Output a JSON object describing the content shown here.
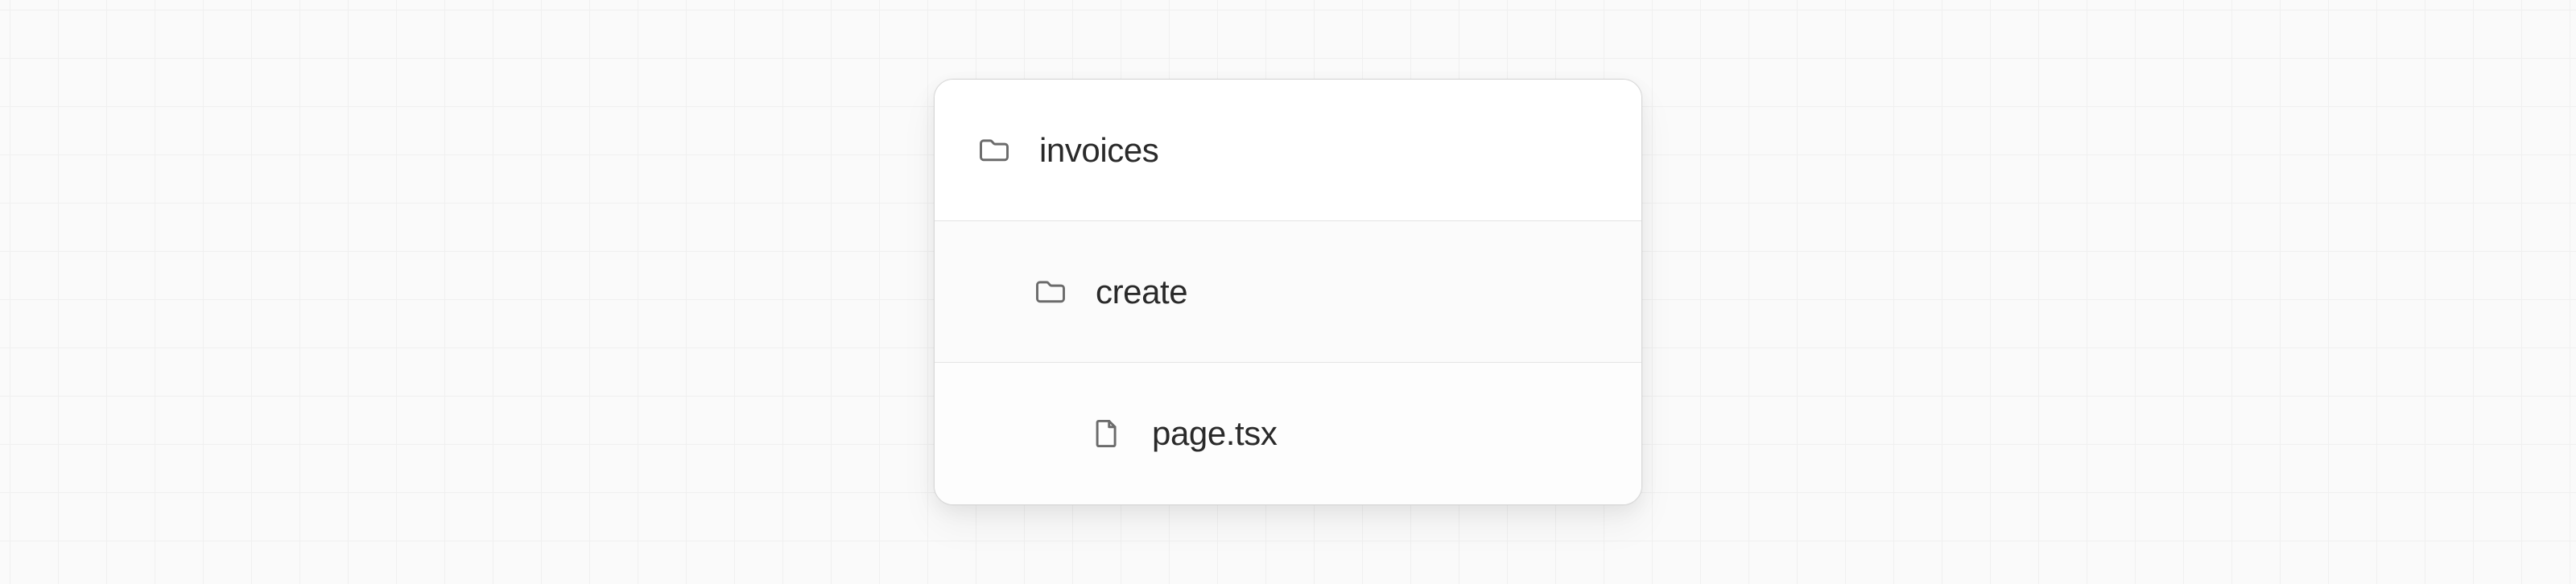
{
  "tree": {
    "level0": {
      "type": "folder",
      "label": "invoices"
    },
    "level1": {
      "type": "folder",
      "label": "create"
    },
    "level2": {
      "type": "file",
      "label": "page.tsx"
    }
  }
}
